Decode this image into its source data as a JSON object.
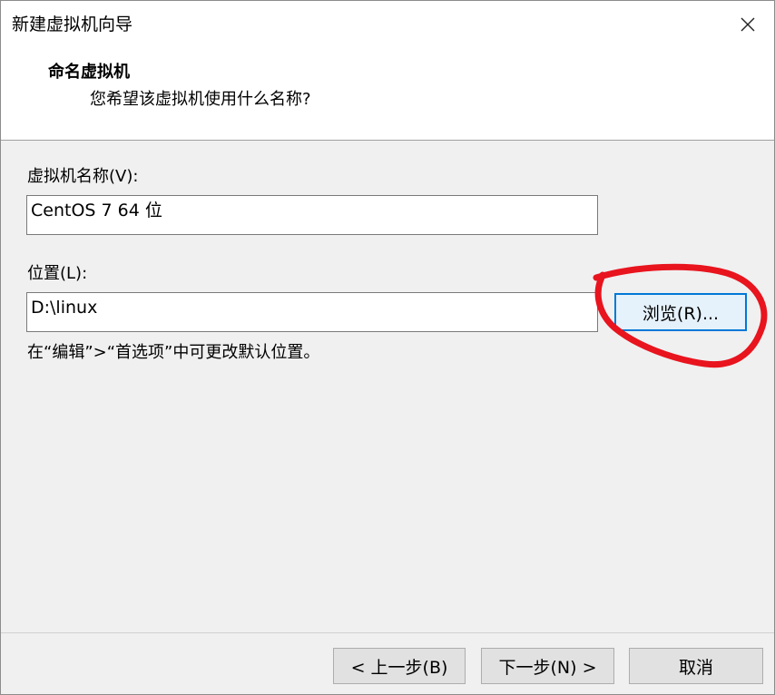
{
  "window": {
    "title": "新建虚拟机向导"
  },
  "header": {
    "title": "命名虚拟机",
    "subtitle": "您希望该虚拟机使用什么名称?"
  },
  "form": {
    "vm_name_label": "虚拟机名称(V):",
    "vm_name_value": "CentOS 7 64 位",
    "location_label": "位置(L):",
    "location_value": "D:\\linux",
    "browse_label": "浏览(R)...",
    "hint": "在“编辑”>“首选项”中可更改默认位置。"
  },
  "footer": {
    "back_label": "< 上一步(B)",
    "next_label": "下一步(N) >",
    "cancel_label": "取消"
  },
  "colors": {
    "dialog_bg": "#f0f0f0",
    "focus_border": "#0078d7",
    "annotation": "#e8141e"
  },
  "icons": {
    "close": "close-icon"
  }
}
